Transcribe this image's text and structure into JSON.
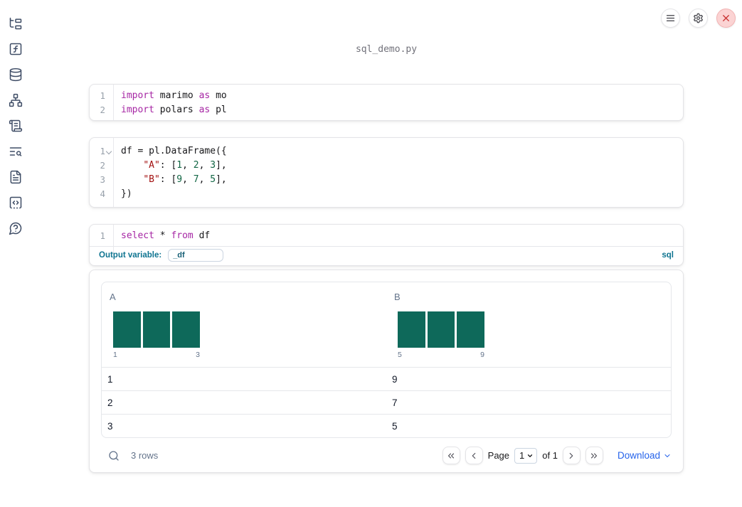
{
  "window": {
    "title": "sql_demo.py"
  },
  "top_controls": {
    "icons": [
      "menu-icon",
      "settings-gear-icon",
      "close-x-icon"
    ]
  },
  "sidebar": {
    "icons": [
      "file-tree-icon",
      "function-square-icon",
      "database-icon",
      "network-graph-icon",
      "scroll-text-icon",
      "list-search-icon",
      "file-text-icon",
      "code-snippet-square-icon",
      "help-question-bubble-icon"
    ]
  },
  "colors": {
    "keyword": "#a626a4",
    "string": "#a31111",
    "number": "#116644",
    "histogram_bar": "#0e695a",
    "teal_label": "#0e7490",
    "download_blue": "#2563eb",
    "close_red": "#c93030"
  },
  "cells": [
    {
      "kind": "python",
      "lines": [
        {
          "num": "1",
          "tokens": [
            [
              "kw",
              "import"
            ],
            [
              "pl",
              " marimo "
            ],
            [
              "kw",
              "as"
            ],
            [
              "pl",
              " mo"
            ]
          ]
        },
        {
          "num": "2",
          "tokens": [
            [
              "kw",
              "import"
            ],
            [
              "pl",
              " polars "
            ],
            [
              "kw",
              "as"
            ],
            [
              "pl",
              " pl"
            ]
          ]
        }
      ]
    },
    {
      "kind": "python",
      "lines": [
        {
          "num": "1",
          "fold": true,
          "tokens": [
            [
              "pl",
              "df = pl.DataFrame({"
            ]
          ]
        },
        {
          "num": "2",
          "tokens": [
            [
              "pl",
              "    "
            ],
            [
              "str",
              "\"A\""
            ],
            [
              "pl",
              ": ["
            ],
            [
              "num",
              "1"
            ],
            [
              "pl",
              ", "
            ],
            [
              "num",
              "2"
            ],
            [
              "pl",
              ", "
            ],
            [
              "num",
              "3"
            ],
            [
              "pl",
              "],"
            ]
          ]
        },
        {
          "num": "3",
          "tokens": [
            [
              "pl",
              "    "
            ],
            [
              "str",
              "\"B\""
            ],
            [
              "pl",
              ": ["
            ],
            [
              "num",
              "9"
            ],
            [
              "pl",
              ", "
            ],
            [
              "num",
              "7"
            ],
            [
              "pl",
              ", "
            ],
            [
              "num",
              "5"
            ],
            [
              "pl",
              "],"
            ]
          ]
        },
        {
          "num": "4",
          "tokens": [
            [
              "pl",
              "})"
            ]
          ]
        }
      ]
    },
    {
      "kind": "sql",
      "lines": [
        {
          "num": "1",
          "tokens": [
            [
              "kw",
              "select"
            ],
            [
              "pl",
              " * "
            ],
            [
              "kw",
              "from"
            ],
            [
              "pl",
              " df"
            ]
          ]
        }
      ],
      "output_variable_label": "Output variable:",
      "output_variable_value": "_df",
      "language_badge": "sql"
    }
  ],
  "table": {
    "columns": [
      {
        "name": "A",
        "histogram": {
          "type": "bar",
          "bars": [
            1,
            1,
            1
          ],
          "min_label": "1",
          "max_label": "3"
        }
      },
      {
        "name": "B",
        "histogram": {
          "type": "bar",
          "bars": [
            1,
            1,
            1
          ],
          "min_label": "5",
          "max_label": "9"
        }
      }
    ],
    "rows": [
      [
        "1",
        "9"
      ],
      [
        "2",
        "7"
      ],
      [
        "3",
        "5"
      ]
    ],
    "footer": {
      "row_count": "3 rows",
      "page_label": "Page",
      "page_value": "1",
      "of_label": "of 1",
      "download_label": "Download"
    }
  }
}
